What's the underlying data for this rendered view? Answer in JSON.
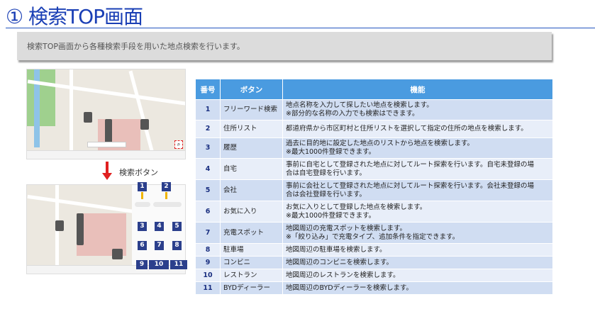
{
  "title": "① 検索TOP画面",
  "description": "検索TOP画面から各種検索手段を用いた地点検索を行います。",
  "annotation_label": "検索ボタン",
  "screenshot_badges": [
    "1",
    "2",
    "3",
    "4",
    "5",
    "6",
    "7",
    "8",
    "9",
    "10",
    "11"
  ],
  "table": {
    "headers": [
      "番号",
      "ボタン",
      "機能"
    ],
    "rows": [
      {
        "no": "1",
        "button": "フリーワード検索",
        "func": [
          "地点名称を入力して探したい地点を検索します。",
          "※部分的な名称の入力でも検索はできます。"
        ]
      },
      {
        "no": "2",
        "button": "住所リスト",
        "func": [
          "都道府県から市区町村と住所リストを選択して指定の住所の地点を検索します。"
        ]
      },
      {
        "no": "3",
        "button": "履歴",
        "func": [
          "過去に目的地に設定した地点のリストから地点を検索します。",
          "※最大1000件登録できます。"
        ]
      },
      {
        "no": "4",
        "button": "自宅",
        "func": [
          "事前に自宅として登録された地点に対してルート探索を行います。自宅未登録の場",
          "合は自宅登録を行います。"
        ]
      },
      {
        "no": "5",
        "button": "会社",
        "func": [
          "事前に会社として登録された地点に対してルート探索を行います。会社未登録の場",
          "合は会社登録を行います。"
        ]
      },
      {
        "no": "6",
        "button": "お気に入り",
        "func": [
          "お気に入りとして登録した地点を検索します。",
          "※最大1000件登録できます。"
        ]
      },
      {
        "no": "7",
        "button": "充電スポット",
        "func": [
          "地図周辺の充電スポットを検索します。",
          "※「絞り込み」で充電タイプ、追加条件を指定できます。"
        ]
      },
      {
        "no": "8",
        "button": "駐車場",
        "func": [
          "地図周辺の駐車場を検索します。"
        ]
      },
      {
        "no": "9",
        "button": "コンビニ",
        "func": [
          "地図周辺のコンビニを検索します。"
        ]
      },
      {
        "no": "10",
        "button": "レストラン",
        "func": [
          "地図周辺のレストランを検索します。"
        ]
      },
      {
        "no": "11",
        "button": "BYDディーラー",
        "func": [
          "地図周辺のBYDディーラーを検索します。"
        ]
      }
    ]
  }
}
